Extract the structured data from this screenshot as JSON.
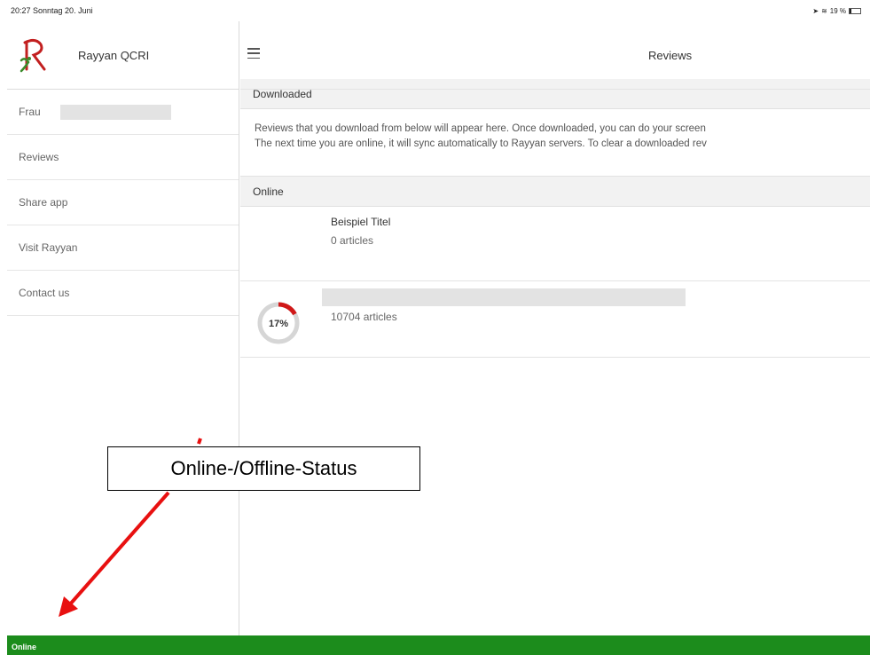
{
  "statusbar": {
    "datetime": "20:27  Sonntag 20. Juni",
    "battery": "19 %",
    "battery_fraction": 0.19
  },
  "sidebar": {
    "app_name": "Rayyan QCRI",
    "user_prefix": "Frau",
    "items": [
      {
        "label": "Reviews"
      },
      {
        "label": "Share app"
      },
      {
        "label": "Visit Rayyan"
      },
      {
        "label": "Contact us"
      }
    ]
  },
  "main": {
    "title": "Reviews",
    "downloaded_heading": "Downloaded",
    "info_line1": "Reviews that you download from below will appear here. Once downloaded, you can do your screen",
    "info_line2": "The next time you are online, it will sync automatically to Rayyan servers. To clear a downloaded rev",
    "online_heading": "Online",
    "reviews": [
      {
        "title": "Beispiel Titel",
        "count": "0 articles"
      },
      {
        "title": "",
        "count": "10704 articles",
        "progress_label": "17%",
        "progress": 0.17
      }
    ]
  },
  "bottombar": {
    "status": "Online"
  },
  "annotation": {
    "label": "Online-/Offline-Status"
  },
  "colors": {
    "status_green": "#1c8c1c",
    "progress_red": "#d01818",
    "progress_track": "#d6d6d6",
    "arrow_red": "#e81010"
  }
}
